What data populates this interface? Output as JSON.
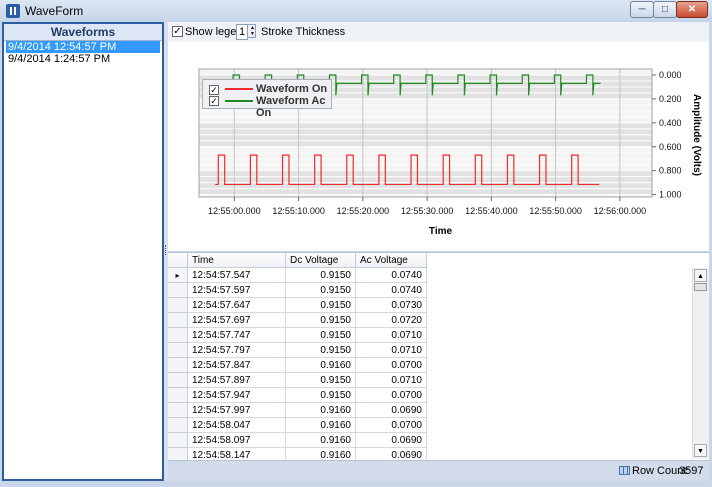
{
  "window": {
    "title": "WaveForm",
    "min_glyph": "─",
    "max_glyph": "□",
    "close_glyph": "✕"
  },
  "waveforms": {
    "header": "Waveforms",
    "items": [
      {
        "label": "9/4/2014 12:54:57 PM",
        "selected": true
      },
      {
        "label": "9/4/2014 1:24:57 PM",
        "selected": false
      }
    ]
  },
  "toolbar": {
    "show_legend_label": "Show legend",
    "show_legend_checked": true,
    "check_glyph": "✓",
    "stroke_value": "1",
    "spin_up_glyph": "▲",
    "spin_down_glyph": "▼",
    "stroke_label": "Stroke Thickness"
  },
  "chart": {
    "legend": [
      {
        "name": "Waveform On",
        "color": "#ee2a2a",
        "checked": true
      },
      {
        "name": "Waveform Ac On",
        "color": "#1f8a1f",
        "checked": true
      }
    ]
  },
  "chart_data": {
    "type": "line",
    "xlabel": "Time",
    "ylabel": "Amplitude (Volts)",
    "x_ticks": [
      "12:55:00.000",
      "12:55:10.000",
      "12:55:20.000",
      "12:55:30.000",
      "12:55:40.000",
      "12:55:50.000",
      "12:56:00.000"
    ],
    "x_tick_seconds": [
      3.0,
      13.0,
      23.0,
      33.0,
      43.0,
      53.0,
      63.0
    ],
    "x_range_seconds": [
      -2.5,
      68.0
    ],
    "y_ticks": [
      "0.000",
      "0.200",
      "0.400",
      "0.600",
      "0.800",
      "1.000"
    ],
    "y_tick_values": [
      0.0,
      0.2,
      0.4,
      0.6,
      0.8,
      1.0
    ],
    "ylim": [
      -0.05,
      1.02
    ],
    "y_inverted": true,
    "series": [
      {
        "name": "Waveform On",
        "color": "#ee2a2a",
        "baseline": 0.915,
        "pulse": 0.67,
        "pulse_start_seconds": 0.5,
        "period_seconds": 5.0,
        "pulse_width_seconds": 1.0,
        "x_end_seconds": 59.8
      },
      {
        "name": "Waveform Ac On",
        "color": "#1f8a1f",
        "baseline": 0.07,
        "pulse": 0.0,
        "dip": 0.17,
        "pulse_start_seconds": 2.8,
        "period_seconds": 5.0,
        "pulse_width_seconds": 1.0,
        "x_end_seconds": 60.0
      }
    ]
  },
  "grid": {
    "columns": [
      "Time",
      "Dc Voltage",
      "Ac Voltage"
    ],
    "current_row_glyph": "▸",
    "rows": [
      [
        "12:54:57.547",
        "0.9150",
        "0.0740"
      ],
      [
        "12:54:57.597",
        "0.9150",
        "0.0740"
      ],
      [
        "12:54:57.647",
        "0.9150",
        "0.0730"
      ],
      [
        "12:54:57.697",
        "0.9150",
        "0.0720"
      ],
      [
        "12:54:57.747",
        "0.9150",
        "0.0710"
      ],
      [
        "12:54:57.797",
        "0.9150",
        "0.0710"
      ],
      [
        "12:54:57.847",
        "0.9160",
        "0.0700"
      ],
      [
        "12:54:57.897",
        "0.9150",
        "0.0710"
      ],
      [
        "12:54:57.947",
        "0.9150",
        "0.0700"
      ],
      [
        "12:54:57.997",
        "0.9160",
        "0.0690"
      ],
      [
        "12:54:58.047",
        "0.9160",
        "0.0700"
      ],
      [
        "12:54:58.097",
        "0.9160",
        "0.0690"
      ],
      [
        "12:54:58.147",
        "0.9160",
        "0.0690"
      ]
    ],
    "scroll_up_glyph": "▲",
    "scroll_down_glyph": "▼"
  },
  "status": {
    "row_count_label": "Row Count:",
    "row_count_value": "3597"
  }
}
